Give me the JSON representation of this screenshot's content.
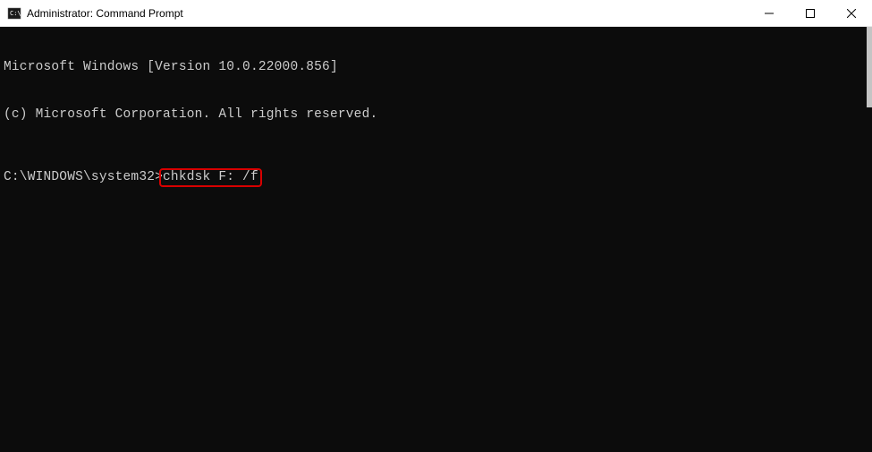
{
  "window": {
    "title": "Administrator: Command Prompt"
  },
  "console": {
    "line1": "Microsoft Windows [Version 10.0.22000.856]",
    "line2": "(c) Microsoft Corporation. All rights reserved.",
    "prompt": "C:\\WINDOWS\\system32>",
    "command": "chkdsk F: /f"
  }
}
